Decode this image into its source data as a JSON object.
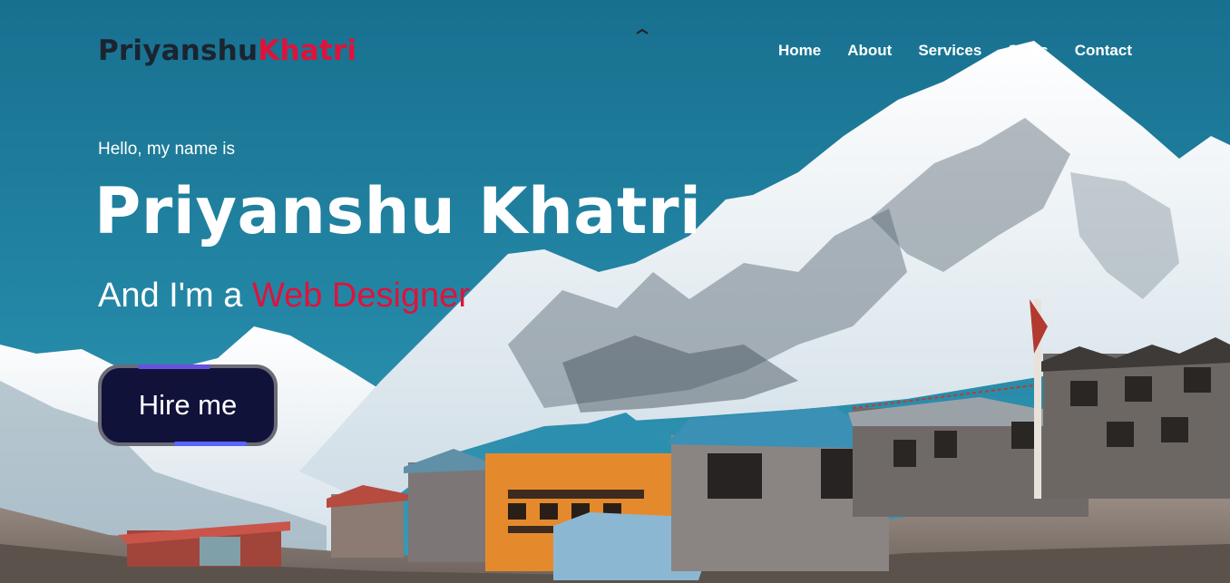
{
  "logo": {
    "first": "Priyanshu",
    "last": "Khatri"
  },
  "nav": {
    "items": [
      {
        "label": "Home"
      },
      {
        "label": "About"
      },
      {
        "label": "Services"
      },
      {
        "label": "Skills"
      },
      {
        "label": "Contact"
      }
    ]
  },
  "hero": {
    "greeting": "Hello, my name is",
    "name": "Priyanshu Khatri",
    "role_prefix": "And I'm a ",
    "role_accent": "Web Designer",
    "cta_label": "Hire me"
  },
  "colors": {
    "accent": "#dc143c",
    "logo_dark": "#1b2430",
    "button_bg": "#11123a",
    "sky": "#1f7f9e"
  }
}
